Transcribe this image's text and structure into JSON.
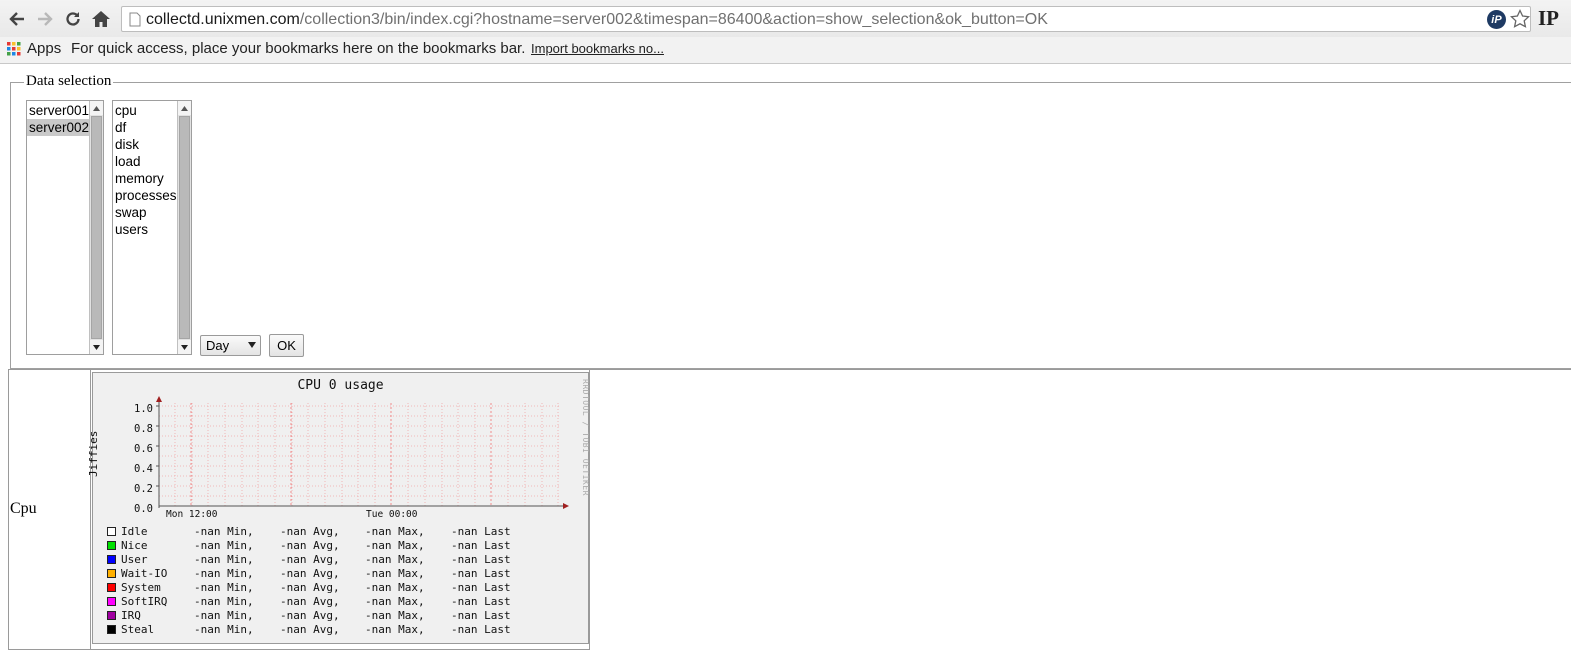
{
  "browser": {
    "url_host": "collectd.unixmen.com",
    "url_path": "/collection3/bin/index.cgi?hostname=server002&timespan=86400&action=show_selection&ok_button=OK",
    "ext_label": "IP"
  },
  "bookmarks_bar": {
    "apps_label": "Apps",
    "hint_text": "For quick access, place your bookmarks here on the bookmarks bar.",
    "import_link": "Import bookmarks no..."
  },
  "selection": {
    "legend": "Data selection",
    "hosts": [
      "server001",
      "server002"
    ],
    "selected_host": "server002",
    "plugins": [
      "cpu",
      "df",
      "disk",
      "load",
      "memory",
      "processes",
      "swap",
      "users"
    ],
    "timespan_value": "Day",
    "ok_label": "OK"
  },
  "results": {
    "row_label": "Cpu",
    "graph": {
      "title": "CPU 0 usage",
      "ylabel": "Jiffies",
      "watermark": "RRDTOOL / TOBI OETIKER",
      "yticks": [
        "1.0",
        "0.8",
        "0.6",
        "0.4",
        "0.2",
        "0.0"
      ],
      "xticks": [
        "Mon 12:00",
        "Tue 00:00"
      ],
      "legend": [
        {
          "name": "Idle",
          "color": "#ffffff",
          "min": "-nan Min,",
          "avg": "-nan Avg,",
          "max": "-nan Max,",
          "last": "-nan Last"
        },
        {
          "name": "Nice",
          "color": "#00e000",
          "min": "-nan Min,",
          "avg": "-nan Avg,",
          "max": "-nan Max,",
          "last": "-nan Last"
        },
        {
          "name": "User",
          "color": "#0000ff",
          "min": "-nan Min,",
          "avg": "-nan Avg,",
          "max": "-nan Max,",
          "last": "-nan Last"
        },
        {
          "name": "Wait-IO",
          "color": "#ffb000",
          "min": "-nan Min,",
          "avg": "-nan Avg,",
          "max": "-nan Max,",
          "last": "-nan Last"
        },
        {
          "name": "System",
          "color": "#ff0000",
          "min": "-nan Min,",
          "avg": "-nan Avg,",
          "max": "-nan Max,",
          "last": "-nan Last"
        },
        {
          "name": "SoftIRQ",
          "color": "#ff00ff",
          "min": "-nan Min,",
          "avg": "-nan Avg,",
          "max": "-nan Max,",
          "last": "-nan Last"
        },
        {
          "name": "IRQ",
          "color": "#a000a0",
          "min": "-nan Min,",
          "avg": "-nan Avg,",
          "max": "-nan Max,",
          "last": "-nan Last"
        },
        {
          "name": "Steal",
          "color": "#000000",
          "min": "-nan Min,",
          "avg": "-nan Avg,",
          "max": "-nan Max,",
          "last": "-nan Last"
        }
      ]
    }
  }
}
